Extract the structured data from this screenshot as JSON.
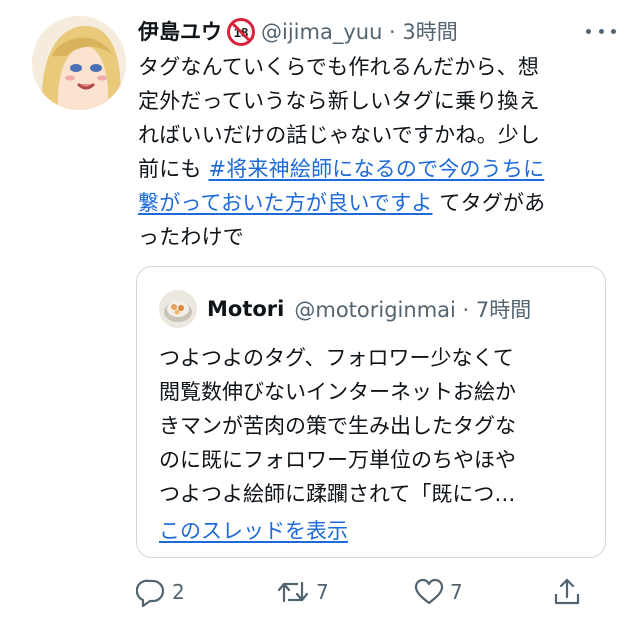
{
  "tweet": {
    "display_name": "伊島ユウ",
    "badge_icon": "no-under-18-icon",
    "handle_time": "@ijima_yuu · 3時間",
    "text_lines": [
      "タグなんていくらでも作れるんだから、想",
      "定外だっていうなら新しいタグに乗り換え",
      "ればいいだけの話じゃないですかね。少し"
    ],
    "line4_prefix": "前にも ",
    "hashtag_part1": "#将来神絵師になるので今のうちに",
    "hashtag_part2": "繋がっておいた方が良いですよ",
    "line5_suffix": " てタグがあ",
    "line6": "ったわけで"
  },
  "quote": {
    "display_name": "Motori",
    "handle_time": "@motoriginmai · 7時間",
    "text_lines": [
      "つよつよのタグ、フォロワー少なくて",
      "閲覧数伸びないインターネットお絵か",
      "きマンが苦肉の策で生み出したタグな",
      "のに既にフォロワー万単位のちやほや",
      "つよつよ絵師に蹂躙されて「既につ…"
    ],
    "show_thread": "このスレッドを表示"
  },
  "actions": {
    "reply_count": "2",
    "retweet_count": "7",
    "like_count": "7"
  },
  "colors": {
    "link": "#1d6ad8",
    "muted": "#536471",
    "text": "#0f1419",
    "border": "#cfd9de"
  }
}
